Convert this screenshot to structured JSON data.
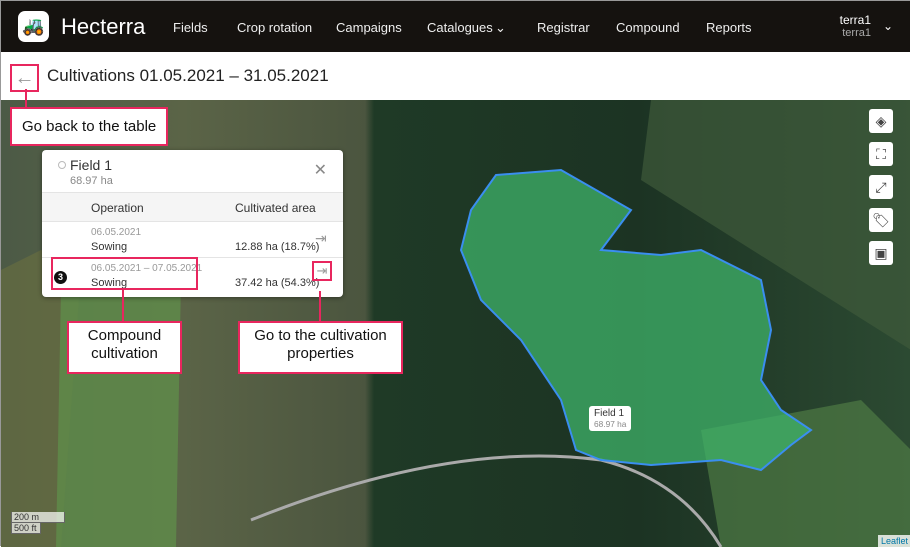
{
  "app": {
    "name": "Hecterra"
  },
  "nav": {
    "items": [
      "Fields",
      "Crop rotation",
      "Campaigns",
      "Catalogues",
      "Registrar",
      "Compound",
      "Reports"
    ]
  },
  "user": {
    "name": "terra1",
    "account": "terra1"
  },
  "page": {
    "title": "Cultivations 01.05.2021 – 31.05.2021"
  },
  "popup": {
    "field": "Field 1",
    "area": "68.97 ha",
    "col_operation": "Operation",
    "col_area": "Cultivated area",
    "rows": [
      {
        "date": "06.05.2021",
        "op": "Sowing",
        "area": "12.88 ha (18.7%)"
      },
      {
        "badge": "3",
        "date": "06.05.2021 – 07.05.2021",
        "op": "Sowing",
        "area": "37.42 ha (54.3%)"
      }
    ]
  },
  "tooltip": {
    "name": "Field 1",
    "area": "68.97 ha"
  },
  "callouts": {
    "back": "Go back to the table",
    "compound": "Compound cultivation",
    "properties": "Go to the cultivation properties"
  },
  "scale": {
    "m": "200 m",
    "ft": "500 ft"
  },
  "attribution": "Leaflet"
}
